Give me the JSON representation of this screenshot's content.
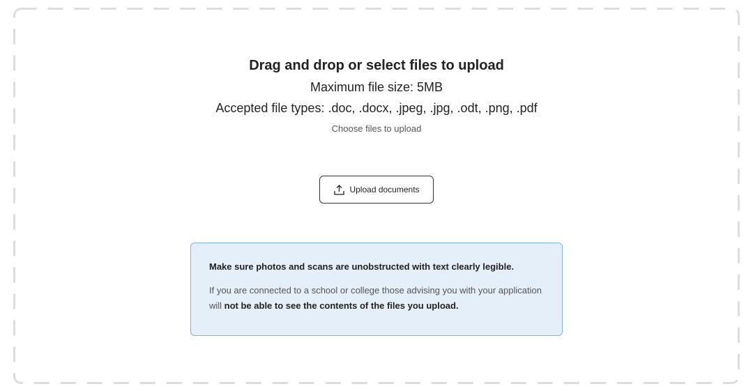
{
  "upload": {
    "title": "Drag and drop or select files to upload",
    "max_size": "Maximum file size: 5MB",
    "accepted_types": "Accepted file types: .doc, .docx, .jpeg, .jpg, .odt, .png, .pdf",
    "choose_text": "Choose files to upload",
    "button_label": "Upload documents",
    "button_icon": "upload-icon"
  },
  "notice": {
    "heading": "Make sure photos and scans are unobstructed with text clearly legible.",
    "body_prefix": "If you are connected to a school or college those advising you with your application will ",
    "body_bold": "not be able to see the contents of the files you upload.",
    "background_color": "#e4eff9",
    "border_color": "#7fb2dd"
  },
  "colors": {
    "dashed_border": "#dddddd",
    "text": "#222222",
    "muted_text": "#555555"
  }
}
